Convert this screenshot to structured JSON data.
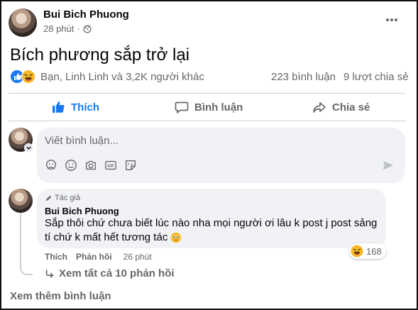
{
  "post": {
    "author": "Bui Bich Phuong",
    "time": "28 phút",
    "privacy_icon": "globe-icon",
    "more_icon": "more-dots-icon",
    "text": "Bích phương sắp trở lại"
  },
  "stats": {
    "reactions_text": "Bạn, Linh Linh và 3,2K người khác",
    "comments": "223 bình luận",
    "shares": "9 lượt chia sẻ"
  },
  "actions": {
    "like": "Thích",
    "comment": "Bình luận",
    "share": "Chia sẻ"
  },
  "composer": {
    "placeholder": "Viết bình luận..."
  },
  "comment": {
    "badge": "Tác giả",
    "author": "Bui Bich Phuong",
    "text_line1": "Sắp thôi chứ chưa biết lúc nào nha mọi người ơi lâu k post j post sảng",
    "text_line2": "tí chứ k mất hết tương tác",
    "like": "Thích",
    "reply": "Phản hồi",
    "time": "26 phút",
    "reaction_count": "168",
    "view_replies": "Xem tất cả 10 phản hồi"
  },
  "more_comments": "Xem thêm bình luận",
  "colors": {
    "accent": "#1877f2",
    "muted": "#65676b",
    "bubble": "#f0f2f5"
  }
}
